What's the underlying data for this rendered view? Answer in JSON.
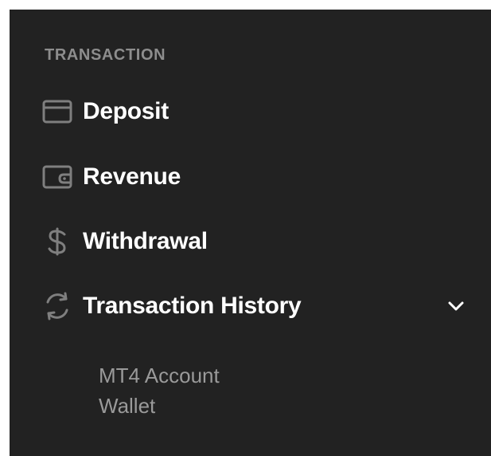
{
  "sidebar": {
    "section_title": "TRANSACTION",
    "items": [
      {
        "label": "Deposit",
        "icon": "credit-card-icon"
      },
      {
        "label": "Revenue",
        "icon": "wallet-icon"
      },
      {
        "label": "Withdrawal",
        "icon": "dollar-sign-icon"
      },
      {
        "label": "Transaction History",
        "icon": "refresh-icon",
        "expanded": true
      }
    ],
    "subitems": [
      {
        "label": "MT4 Account"
      },
      {
        "label": "Wallet"
      }
    ],
    "colors": {
      "background": "#222222",
      "primary_text": "#ffffff",
      "secondary_text": "#9a9a9a",
      "icon": "#7f7f7f"
    }
  }
}
